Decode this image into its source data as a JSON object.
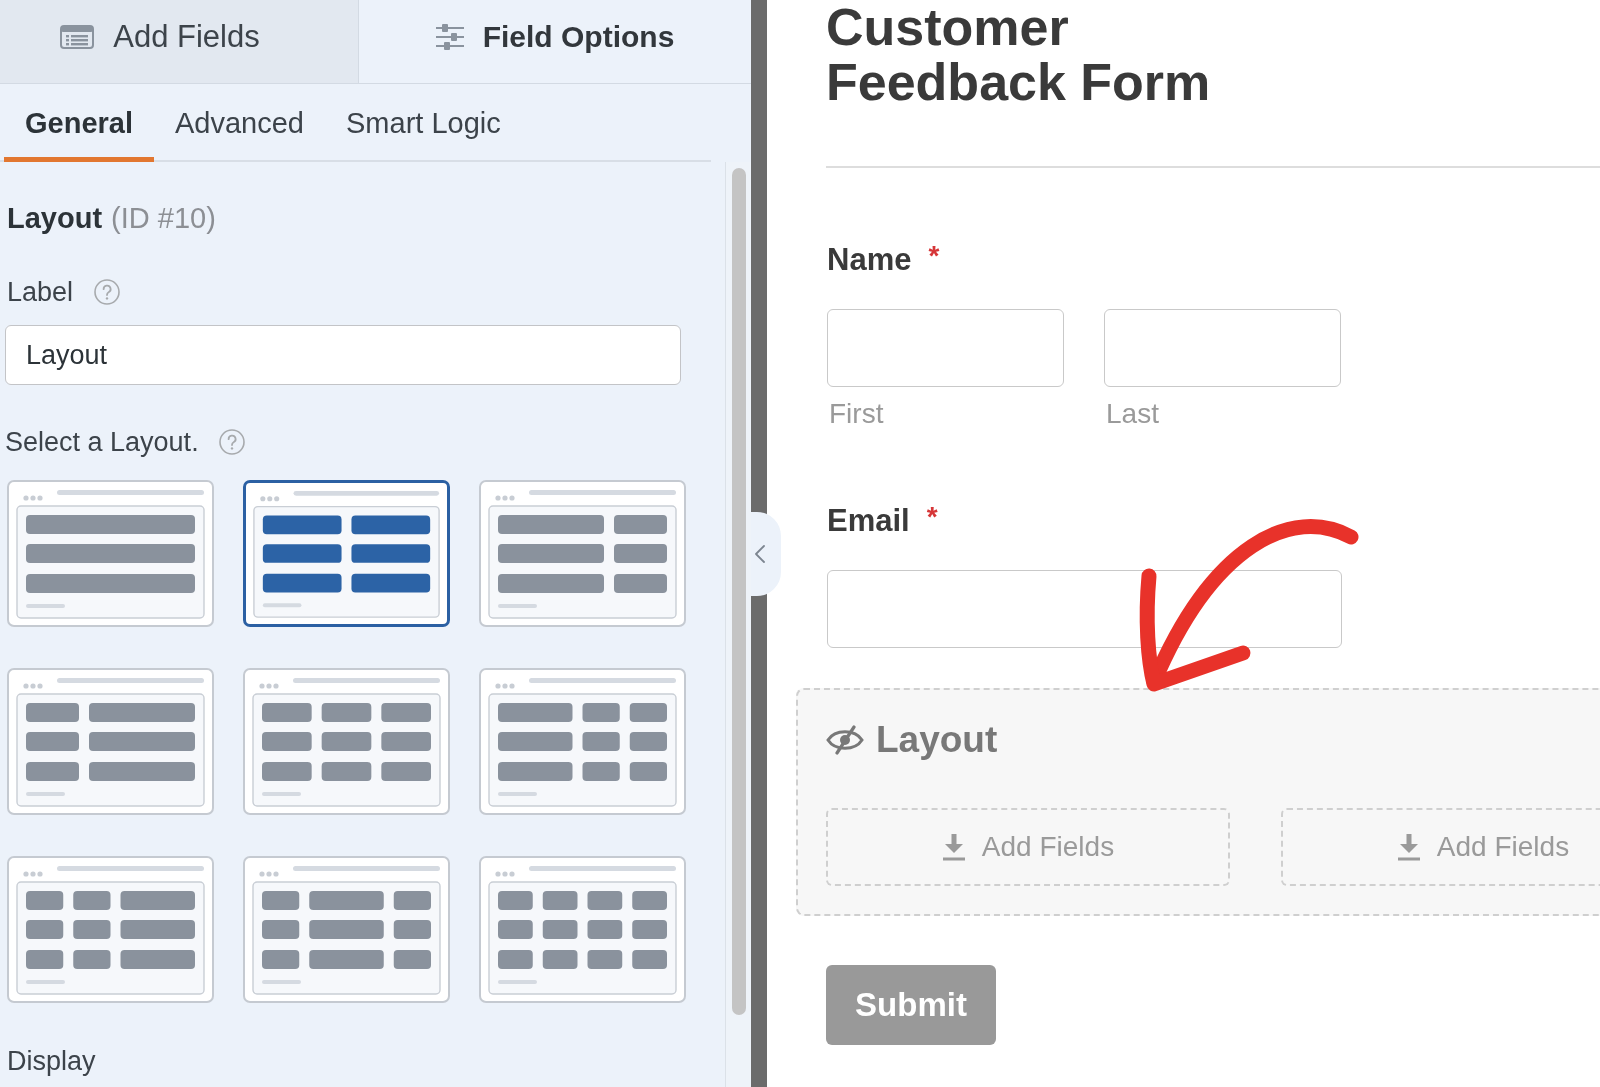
{
  "panel_tabs": [
    {
      "kind": "fields",
      "label": "Add Fields",
      "selected": false
    },
    {
      "kind": "options",
      "label": "Field Options",
      "selected": true
    }
  ],
  "sub_tabs": [
    {
      "label": "General",
      "selected": true
    },
    {
      "label": "Advanced",
      "selected": false
    },
    {
      "label": "Smart Logic",
      "selected": false
    }
  ],
  "field_heading": {
    "title": "Layout",
    "id": "(ID #10)"
  },
  "label_setting": {
    "label": "Label",
    "value": "Layout"
  },
  "layout_setting": {
    "label": "Select a Layout.",
    "options": [
      {
        "kind": "single",
        "selected": false
      },
      {
        "kind": "halves",
        "selected": true
      },
      {
        "kind": "wideleft",
        "selected": false
      },
      {
        "kind": "wideright",
        "selected": false
      },
      {
        "kind": "thirds",
        "selected": false
      },
      {
        "kind": "halfleft",
        "selected": false
      },
      {
        "kind": "halfright",
        "selected": false
      },
      {
        "kind": "halfcenter",
        "selected": false
      },
      {
        "kind": "quarters",
        "selected": false
      }
    ]
  },
  "next_section": "Display",
  "form": {
    "title": "Customer Feedback Form",
    "fields": [
      {
        "kind": "name",
        "label": "Name",
        "required_mark": "*",
        "sublabels": [
          "First",
          "Last"
        ]
      },
      {
        "kind": "email",
        "label": "Email",
        "required_mark": "*"
      },
      {
        "kind": "layout",
        "label": "Layout",
        "drop_zones": [
          "Add Fields",
          "Add Fields"
        ]
      }
    ],
    "submit": "Submit"
  }
}
